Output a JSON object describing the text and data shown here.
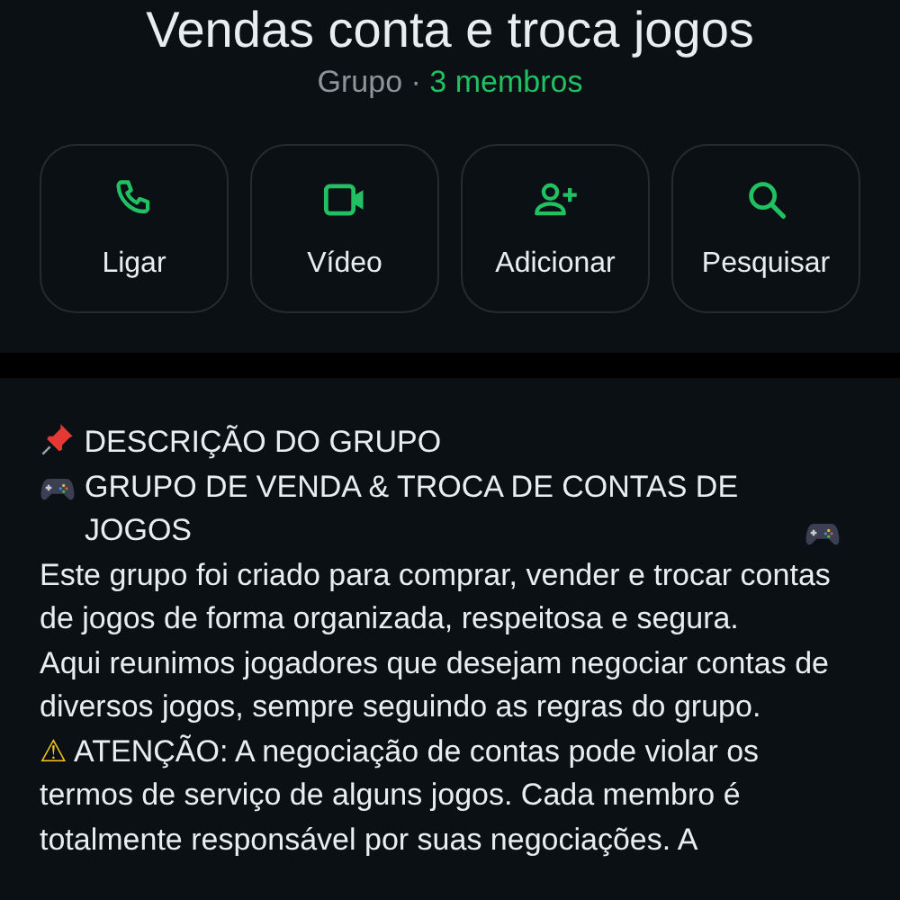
{
  "group": {
    "title": "Vendas conta e troca jogos",
    "type_label": "Grupo",
    "separator": "·",
    "members": "3 membros"
  },
  "actions": [
    {
      "kind": "call",
      "label": "Ligar"
    },
    {
      "kind": "video",
      "label": "Vídeo"
    },
    {
      "kind": "add",
      "label": "Adicionar"
    },
    {
      "kind": "search",
      "label": "Pesquisar"
    }
  ],
  "description": [
    {
      "kind": "pinned",
      "text": "DESCRIÇÃO DO GRUPO"
    },
    {
      "kind": "game_title",
      "text": "GRUPO DE VENDA & TROCA DE CONTAS DE JOGOS"
    },
    {
      "kind": "plain",
      "text": "Este grupo foi criado para comprar, vender e trocar contas de jogos de forma organizada, respeitosa e segura."
    },
    {
      "kind": "plain",
      "text": "Aqui reunimos jogadores que desejam negociar contas de diversos jogos, sempre seguindo as regras do grupo."
    },
    {
      "kind": "warning",
      "symbol": "⚠",
      "text": "ATENÇÃO: A negociação de contas pode violar os termos de serviço de alguns jogos. Cada membro é totalmente responsável por suas negociações. A"
    }
  ]
}
